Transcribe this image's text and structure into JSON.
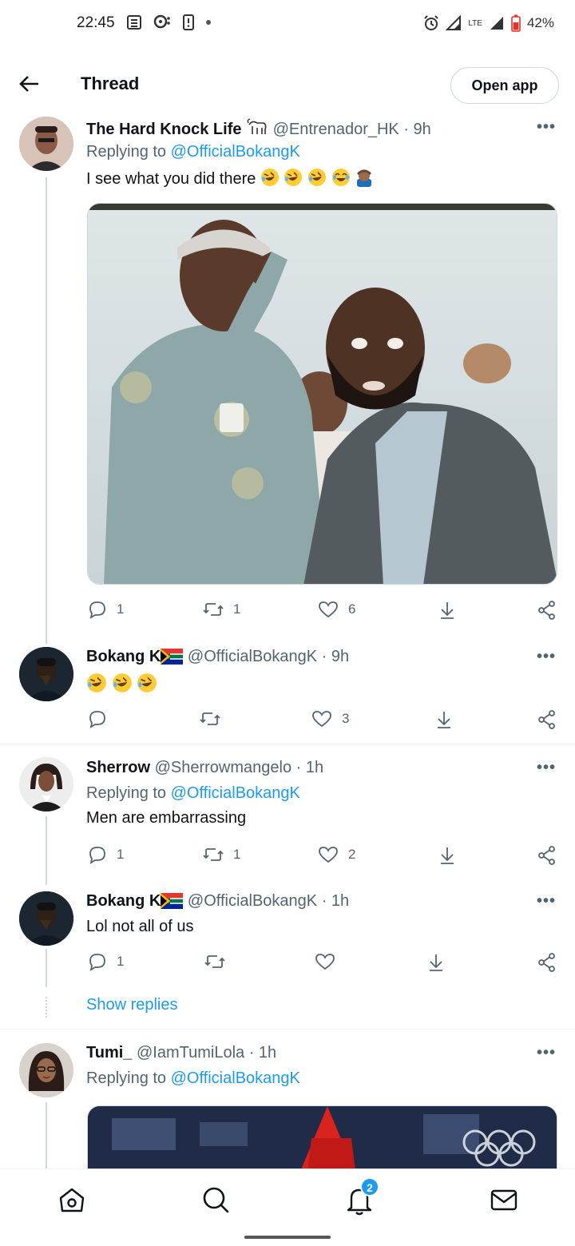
{
  "status_bar": {
    "time": "22:45",
    "battery": "42%",
    "network": "LTE"
  },
  "header": {
    "title": "Thread",
    "open_app": "Open app"
  },
  "tweets": [
    {
      "name": "The Hard Knock Life",
      "handle": "@Entrenador_HK",
      "time": "· 9h",
      "replying_prefix": "Replying to",
      "replying_to": "@OfficialBokangK",
      "text": "I see what you did there",
      "emojis": [
        "rofl",
        "rofl",
        "rofl",
        "joy",
        "facepalm"
      ],
      "replies": "1",
      "retweets": "1",
      "likes": "6"
    },
    {
      "name": "Bokang K",
      "handle": "@OfficialBokangK",
      "time": "· 9h",
      "text": "",
      "emojis": [
        "rofl",
        "rofl",
        "rofl"
      ],
      "replies": "",
      "retweets": "",
      "likes": "3"
    },
    {
      "name": "Sherrow",
      "handle": "@Sherrowmangelo",
      "time": "· 1h",
      "replying_prefix": "Replying to",
      "replying_to": "@OfficialBokangK",
      "text": "Men are embarrassing",
      "replies": "1",
      "retweets": "1",
      "likes": "2"
    },
    {
      "name": "Bokang K",
      "handle": "@OfficialBokangK",
      "time": "· 1h",
      "text": "Lol not all of us",
      "replies": "1",
      "retweets": "",
      "likes": ""
    },
    {
      "name": "Tumi_",
      "handle": "@IamTumiLola",
      "time": "· 1h",
      "replying_prefix": "Replying to",
      "replying_to": "@OfficialBokangK"
    }
  ],
  "show_replies": "Show replies",
  "more_label": "•••",
  "notifications_badge": "2",
  "colors": {
    "accent": "#1d9bf0",
    "text": "#0f1419",
    "muted": "#536471",
    "border": "#cfd9de"
  }
}
